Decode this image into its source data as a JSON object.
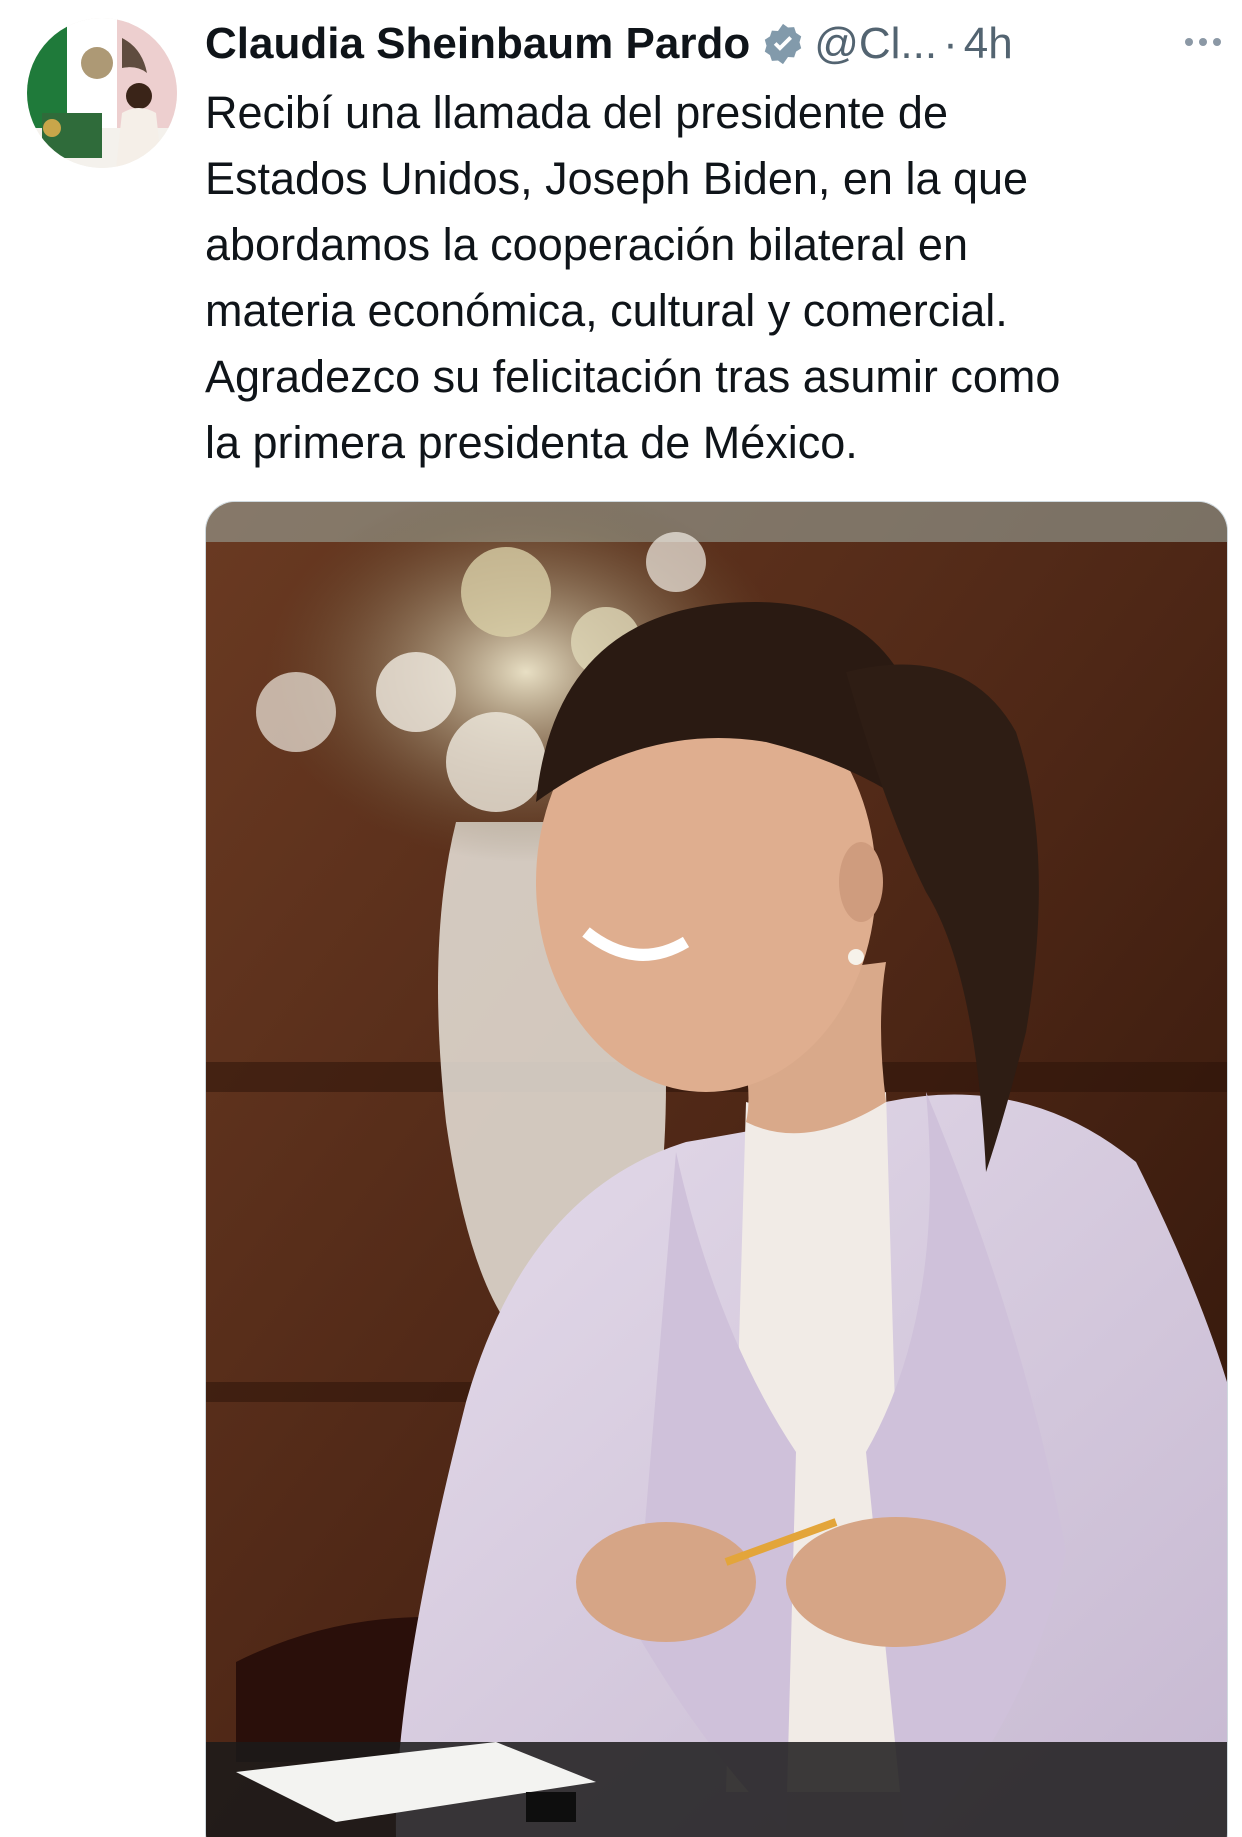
{
  "tweet": {
    "author_name": "Claudia Sheinbaum Pardo",
    "handle": "@Cl...",
    "separator": "·",
    "time": "4h",
    "text": "Recibí una llamada del presidente de\nEstados Unidos, Joseph Biden, en la que\nabordamos la cooperación bilateral en\nmateria económica, cultural y comercial.\nAgradezco su felicitación tras asumir como\nla primera presidenta de México.",
    "verified": true
  },
  "icons": {
    "verified": "verified-badge-icon",
    "more": "more-options-icon"
  },
  "colors": {
    "text_primary": "#0f1419",
    "text_secondary": "#536471",
    "verified_badge": "#829aab",
    "jacket": "#d7cbe0",
    "background_wood": "#5a2f1e"
  }
}
